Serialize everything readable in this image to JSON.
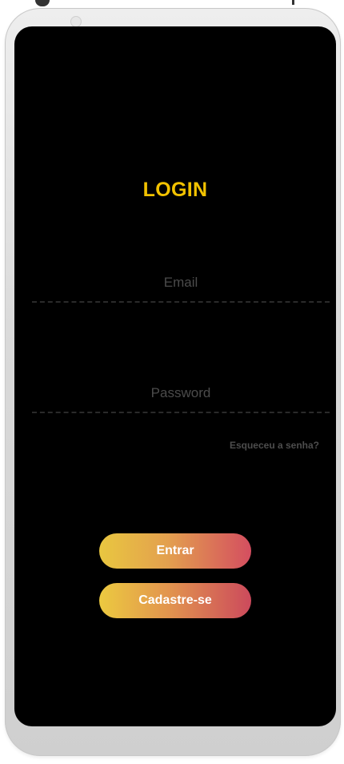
{
  "login": {
    "title": "LOGIN",
    "email_placeholder": "Email",
    "password_placeholder": "Password",
    "forgot_label": "Esqueceu a senha?",
    "submit_label": "Entrar",
    "signup_label": "Cadastre-se"
  },
  "colors": {
    "screen_background": "#000000",
    "title": "#f2c200",
    "button_gradient_start": "#e9c740",
    "button_gradient_end": "#d44e60",
    "placeholder": "#4b4b4b"
  }
}
